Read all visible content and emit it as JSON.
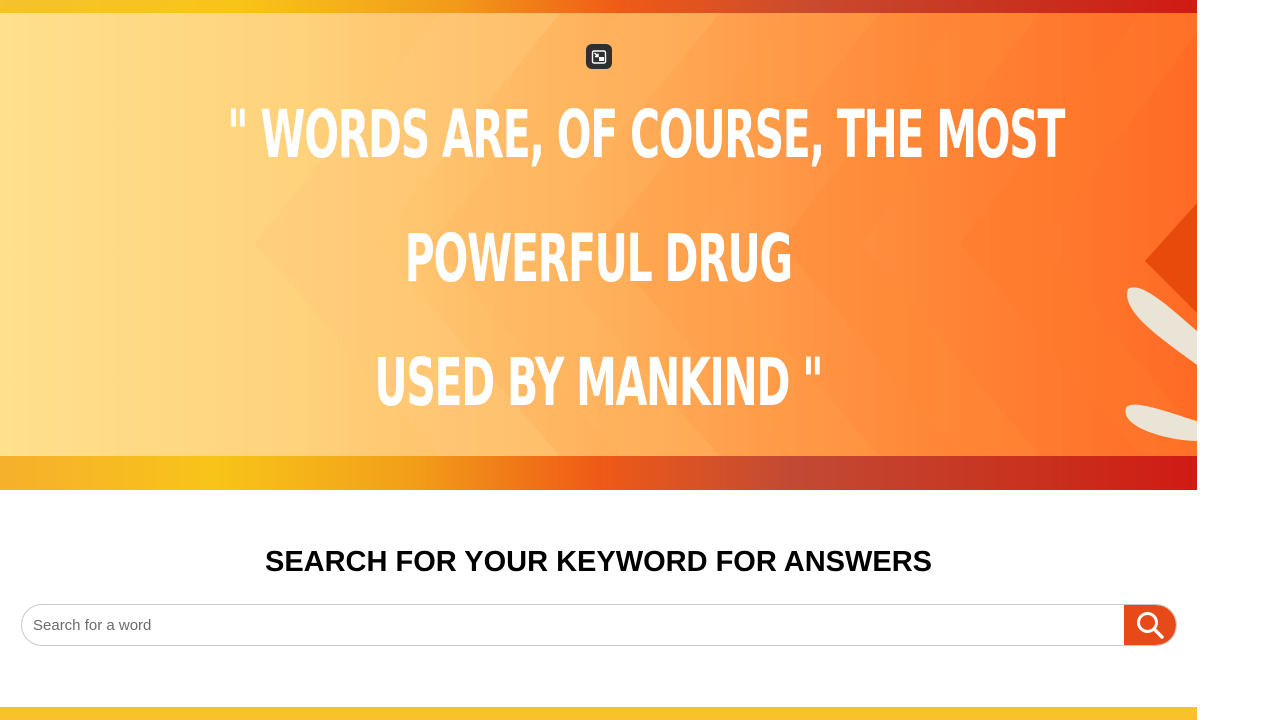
{
  "banner": {
    "quote_line_1": "\" WORDS ARE, OF COURSE, THE MOST",
    "quote_line_2": "POWERFUL DRUG",
    "quote_line_3": "USED BY MANKIND \"",
    "pip_icon": "picture-in-picture-exit-icon"
  },
  "search": {
    "heading": "SEARCH FOR YOUR KEYWORD FOR ANSWERS",
    "placeholder": "Search for a word",
    "value": "",
    "button_icon": "search-icon"
  },
  "colors": {
    "accent": "#e64a19",
    "banner_light": "#ffe08d",
    "banner_dark": "#ff6a24",
    "stripe_yellow": "#f8c419",
    "stripe_red": "#d01a14"
  }
}
